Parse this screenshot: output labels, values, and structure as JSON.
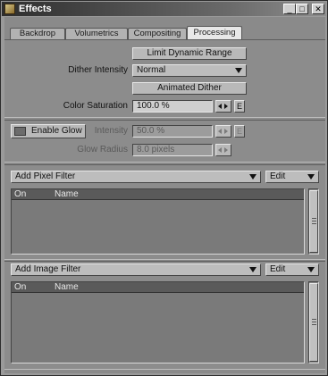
{
  "window": {
    "title": "Effects",
    "controls": {
      "minimize": "_",
      "maximize": "□",
      "close": "✕"
    }
  },
  "tabs": [
    {
      "label": "Backdrop",
      "active": false
    },
    {
      "label": "Volumetrics",
      "active": false
    },
    {
      "label": "Compositing",
      "active": false
    },
    {
      "label": "Processing",
      "active": true
    }
  ],
  "processing": {
    "limit_dynamic_range_label": "Limit Dynamic Range",
    "dither_intensity_label": "Dither Intensity",
    "dither_intensity_value": "Normal",
    "animated_dither_label": "Animated Dither",
    "color_saturation_label": "Color Saturation",
    "color_saturation_value": "100.0 %",
    "envelope_label": "E"
  },
  "glow": {
    "enable_glow_label": "Enable Glow",
    "enabled": false,
    "intensity_label": "Intensity",
    "intensity_value": "50.0 %",
    "glow_radius_label": "Glow Radius",
    "glow_radius_value": "8.0 pixels",
    "envelope_label": "E"
  },
  "pixel_filter": {
    "add_label": "Add Pixel Filter",
    "edit_label": "Edit",
    "columns": [
      "On",
      "Name"
    ],
    "rows": []
  },
  "image_filter": {
    "add_label": "Add Image Filter",
    "edit_label": "Edit",
    "columns": [
      "On",
      "Name"
    ],
    "rows": []
  },
  "icons": [
    "app-icon",
    "chevron-down-icon",
    "spin-arrows-icon",
    "scrollbar-grip-icon"
  ],
  "colors": {
    "titlebar": "#2e2e2e",
    "panel": "#8c8c8c",
    "active_tab": "#e8e8e8"
  }
}
